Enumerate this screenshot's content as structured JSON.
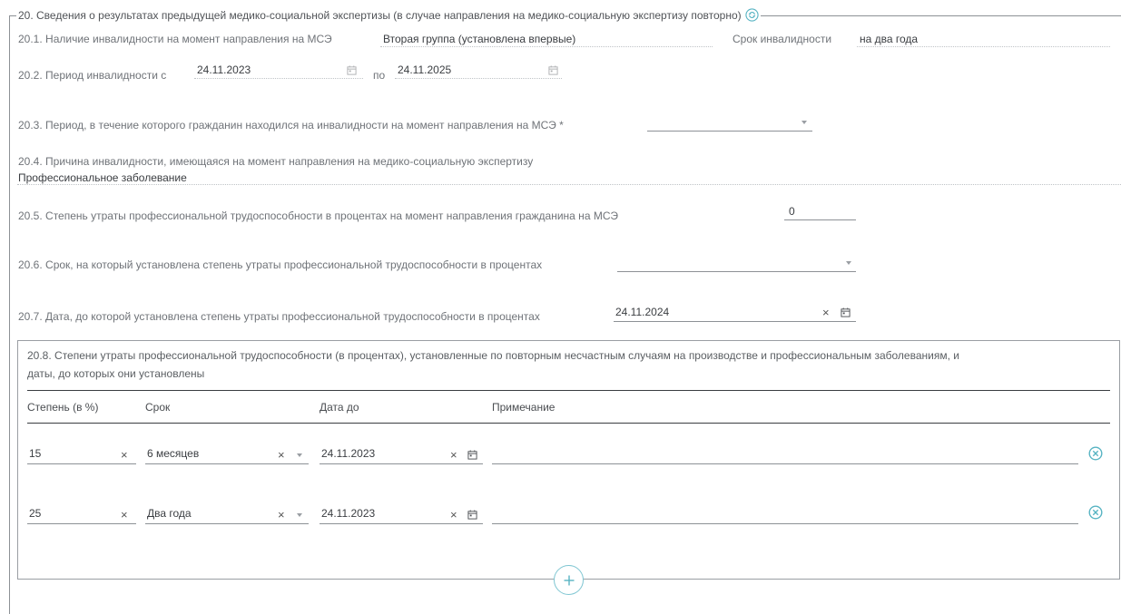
{
  "section": {
    "title": "20. Сведения о результатах предыдущей медико-социальной экспертизы (в случае направления на медико-социальную экспертизу повторно)"
  },
  "f20_1": {
    "label": "20.1. Наличие инвалидности на момент направления на МСЭ",
    "value": "Вторая группа (установлена впервые)",
    "term_label": "Срок инвалидности",
    "term_value": "на два года"
  },
  "f20_2": {
    "label": "20.2. Период инвалидности с",
    "from": "24.11.2023",
    "to_label": "по",
    "to": "24.11.2025"
  },
  "f20_3": {
    "label": "20.3. Период, в течение которого гражданин находился на инвалидности на момент направления на МСЭ *",
    "value": ""
  },
  "f20_4": {
    "label": "20.4. Причина инвалидности, имеющаяся на момент направления на медико-социальную экспертизу",
    "value": "Профессиональное заболевание"
  },
  "f20_5": {
    "label": "20.5. Степень утраты профессиональной трудоспособности в процентах на момент направления гражданина на МСЭ",
    "value": "0"
  },
  "f20_6": {
    "label": "20.6. Срок, на который установлена степень утраты профессиональной трудоспособности в процентах",
    "value": ""
  },
  "f20_7": {
    "label": "20.7. Дата, до которой установлена степень утраты профессиональной трудоспособности в процентах",
    "value": "24.11.2024"
  },
  "f20_8": {
    "title_line1": "20.8. Степени утраты профессиональной трудоспособности (в процентах), установленные по повторным несчастным случаям на производстве и профессиональным заболеваниям, и",
    "title_line2": "даты, до которых они установлены",
    "columns": [
      "Степень (в %)",
      "Срок",
      "Дата до",
      "Примечание"
    ],
    "rows": [
      {
        "degree": "15",
        "term": "6 месяцев",
        "date": "24.11.2023",
        "note": ""
      },
      {
        "degree": "25",
        "term": "Два года",
        "date": "24.11.2023",
        "note": ""
      }
    ]
  },
  "colors": {
    "accent": "#58b4c3",
    "text": "#3a3d41",
    "label": "#6f7378",
    "border": "#8d9196"
  },
  "icons": {
    "refresh": "refresh-icon",
    "calendar": "calendar-icon",
    "clear": "clear-icon",
    "dropdown": "chevron-down-icon",
    "delete": "delete-circle-icon",
    "add": "plus-circle-icon"
  }
}
